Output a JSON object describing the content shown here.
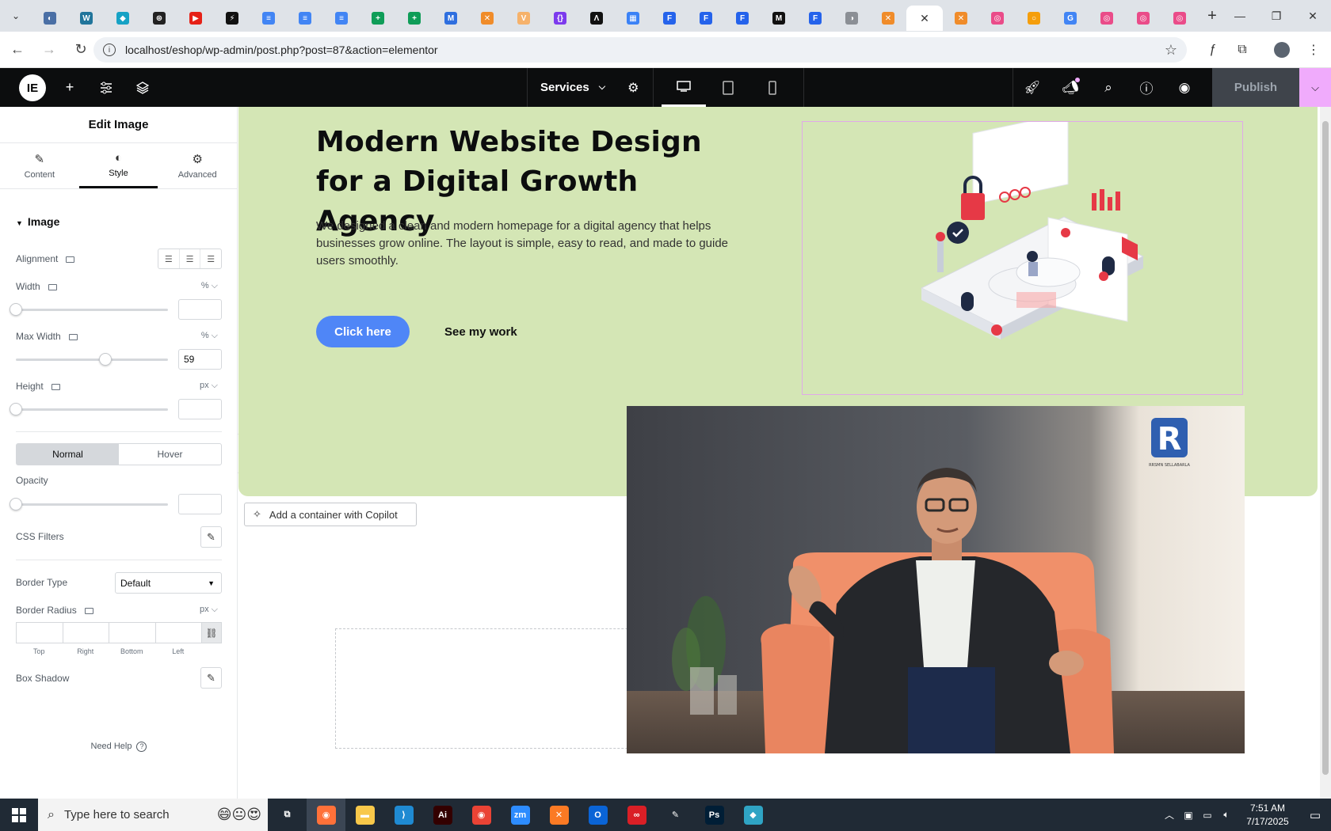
{
  "browser": {
    "url": "localhost/eshop/wp-admin/post.php?post=87&action=elementor",
    "tabs": [
      {
        "icon": "globe-tab-icon",
        "color": "#4a6fa5",
        "glyph": "◐"
      },
      {
        "icon": "wordpress-tab-icon",
        "color": "#21759b",
        "glyph": "W"
      },
      {
        "icon": "cyan-tab-icon",
        "color": "#16a2c5",
        "glyph": "◆"
      },
      {
        "icon": "openai-tab-icon",
        "color": "#222222",
        "glyph": "⊛"
      },
      {
        "icon": "youtube-tab-icon",
        "color": "#e62117",
        "glyph": "▶"
      },
      {
        "icon": "bolt-tab-icon",
        "color": "#111111",
        "glyph": "⚡"
      },
      {
        "icon": "docs-tab-icon",
        "color": "#4285f4",
        "glyph": "≡"
      },
      {
        "icon": "docs-tab-icon",
        "color": "#4285f4",
        "glyph": "≡"
      },
      {
        "icon": "docs-tab-icon",
        "color": "#4285f4",
        "glyph": "≡"
      },
      {
        "icon": "sheets-tab-icon",
        "color": "#0f9d58",
        "glyph": "+"
      },
      {
        "icon": "sheets-tab-icon",
        "color": "#0f9d58",
        "glyph": "+"
      },
      {
        "icon": "blue-tab-icon",
        "color": "#2f6fdf",
        "glyph": "M"
      },
      {
        "icon": "xampp-tab-icon",
        "color": "#f08c2a",
        "glyph": "✕"
      },
      {
        "icon": "vue-tab-icon",
        "color": "#f6b26b",
        "glyph": "V"
      },
      {
        "icon": "code-tab-icon",
        "color": "#7c3aed",
        "glyph": "{}"
      },
      {
        "icon": "lambda-tab-icon",
        "color": "#111111",
        "glyph": "Λ"
      },
      {
        "icon": "grid-tab-icon",
        "color": "#3b82f6",
        "glyph": "▦"
      },
      {
        "icon": "forms-tab-icon",
        "color": "#2563eb",
        "glyph": "F"
      },
      {
        "icon": "forms-tab-icon",
        "color": "#2563eb",
        "glyph": "F"
      },
      {
        "icon": "forms-tab-icon",
        "color": "#2563eb",
        "glyph": "F"
      },
      {
        "icon": "m-tab-icon",
        "color": "#111111",
        "glyph": "M"
      },
      {
        "icon": "forms-tab-icon",
        "color": "#2563eb",
        "glyph": "F"
      },
      {
        "icon": "gray-tab-icon",
        "color": "#8b8f95",
        "glyph": "◑"
      },
      {
        "icon": "xampp-tab-icon",
        "color": "#f08c2a",
        "glyph": "✕"
      },
      {
        "icon": "close-tab-icon",
        "color": "#ffffff",
        "glyph": "✕",
        "active": true
      },
      {
        "icon": "xampp-tab-icon",
        "color": "#f08c2a",
        "glyph": "✕"
      },
      {
        "icon": "dribbble-tab-icon",
        "color": "#ea4c89",
        "glyph": "◎"
      },
      {
        "icon": "ring-tab-icon",
        "color": "#f59e0b",
        "glyph": "○"
      },
      {
        "icon": "google-tab-icon",
        "color": "#4285f4",
        "glyph": "G"
      },
      {
        "icon": "dribbble-tab-icon",
        "color": "#ea4c89",
        "glyph": "◎"
      },
      {
        "icon": "dribbble-tab-icon",
        "color": "#ea4c89",
        "glyph": "◎"
      },
      {
        "icon": "dribbble-tab-icon",
        "color": "#ea4c89",
        "glyph": "◎"
      }
    ]
  },
  "editor": {
    "page_name": "Services",
    "publish_label": "Publish"
  },
  "panel": {
    "title": "Edit Image",
    "tabs": {
      "content": "Content",
      "style": "Style",
      "advanced": "Advanced"
    },
    "section": "Image",
    "alignment_label": "Alignment",
    "width_label": "Width",
    "width_unit": "%",
    "width_value": "",
    "max_width_label": "Max Width",
    "max_width_unit": "%",
    "max_width_value": "59",
    "height_label": "Height",
    "height_unit": "px",
    "height_value": "",
    "normal_label": "Normal",
    "hover_label": "Hover",
    "opacity_label": "Opacity",
    "opacity_value": "",
    "css_filters_label": "CSS Filters",
    "border_type_label": "Border Type",
    "border_type_value": "Default",
    "border_radius_label": "Border Radius",
    "border_radius_unit": "px",
    "radius_labels": {
      "top": "Top",
      "right": "Right",
      "bottom": "Bottom",
      "left": "Left"
    },
    "box_shadow_label": "Box Shadow",
    "need_help": "Need Help"
  },
  "canvas": {
    "heading": "Modern Website Design for a Digital Growth Agency",
    "description": "We designed a clean and modern homepage for a digital agency that helps businesses grow online. The layout is simple, easy to read, and made to guide users smoothly.",
    "primary_button": "Click here",
    "secondary_button": "See my work",
    "copilot_button": "Add a container with Copilot",
    "logo_caption": "RRSMN SELLABARLA"
  },
  "taskbar": {
    "search_placeholder": "Type here to search",
    "time": "7:51 AM",
    "date": "7/17/2025",
    "apps": [
      {
        "name": "task-view",
        "color": "transparent",
        "glyph": "⧉"
      },
      {
        "name": "firefox",
        "color": "#ff7139",
        "glyph": "◉",
        "active": true
      },
      {
        "name": "file-explorer",
        "color": "#f8c84a",
        "glyph": "▬"
      },
      {
        "name": "vscode",
        "color": "#1f8ad2",
        "glyph": "⟩"
      },
      {
        "name": "illustrator",
        "color": "#330000",
        "glyph": "Ai"
      },
      {
        "name": "chrome",
        "color": "#ea4335",
        "glyph": "◉"
      },
      {
        "name": "zoom",
        "color": "#2d8cff",
        "glyph": "zm"
      },
      {
        "name": "xampp",
        "color": "#fb7a24",
        "glyph": "✕"
      },
      {
        "name": "outlook",
        "color": "#0a64d6",
        "glyph": "O"
      },
      {
        "name": "creative-cloud",
        "color": "#da1f26",
        "glyph": "∞"
      },
      {
        "name": "pen-tool",
        "color": "transparent",
        "glyph": "✎"
      },
      {
        "name": "photoshop",
        "color": "#001e36",
        "glyph": "Ps"
      },
      {
        "name": "teal-app",
        "color": "#2fa4c4",
        "glyph": "◆"
      }
    ]
  }
}
